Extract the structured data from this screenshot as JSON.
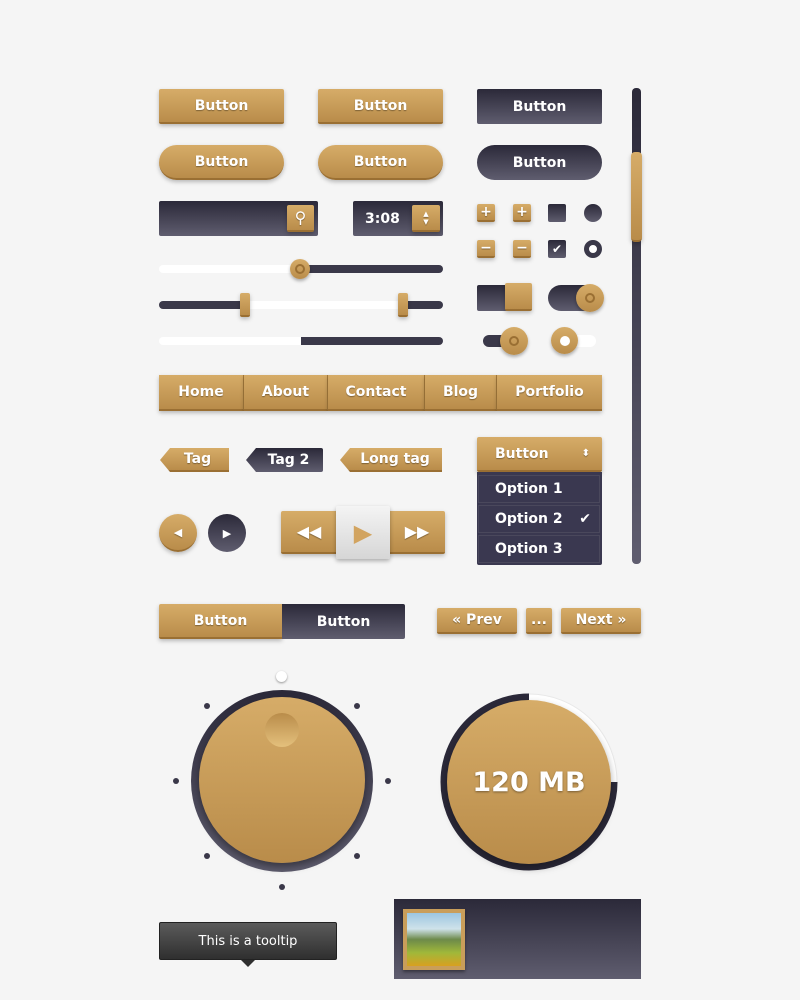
{
  "buttons": {
    "gold1": "Button",
    "gold2": "Button",
    "dark1": "Button",
    "goldPill1": "Button",
    "goldPill2": "Button",
    "darkPill": "Button"
  },
  "time_input": {
    "value": "3:08"
  },
  "sliders": {
    "single_value": 0.5,
    "range": [
      0.3,
      0.86
    ],
    "progress": 0.5
  },
  "nav": [
    "Home",
    "About",
    "Contact",
    "Blog",
    "Portfolio"
  ],
  "tags": [
    "Tag",
    "Tag 2",
    "Long tag"
  ],
  "dropdown": {
    "label": "Button",
    "options": [
      "Option 1",
      "Option 2",
      "Option 3"
    ],
    "selected": "Option 2"
  },
  "segmented": [
    "Button",
    "Button"
  ],
  "pagination": {
    "prev": "« Prev",
    "ellipsis": "...",
    "next": "Next »"
  },
  "gauge": {
    "label": "120 MB",
    "fraction": 0.75
  },
  "tooltip": {
    "text": "This is a tooltip"
  },
  "colors": {
    "gold": "#c99e5a",
    "dark": "#2b2939"
  }
}
